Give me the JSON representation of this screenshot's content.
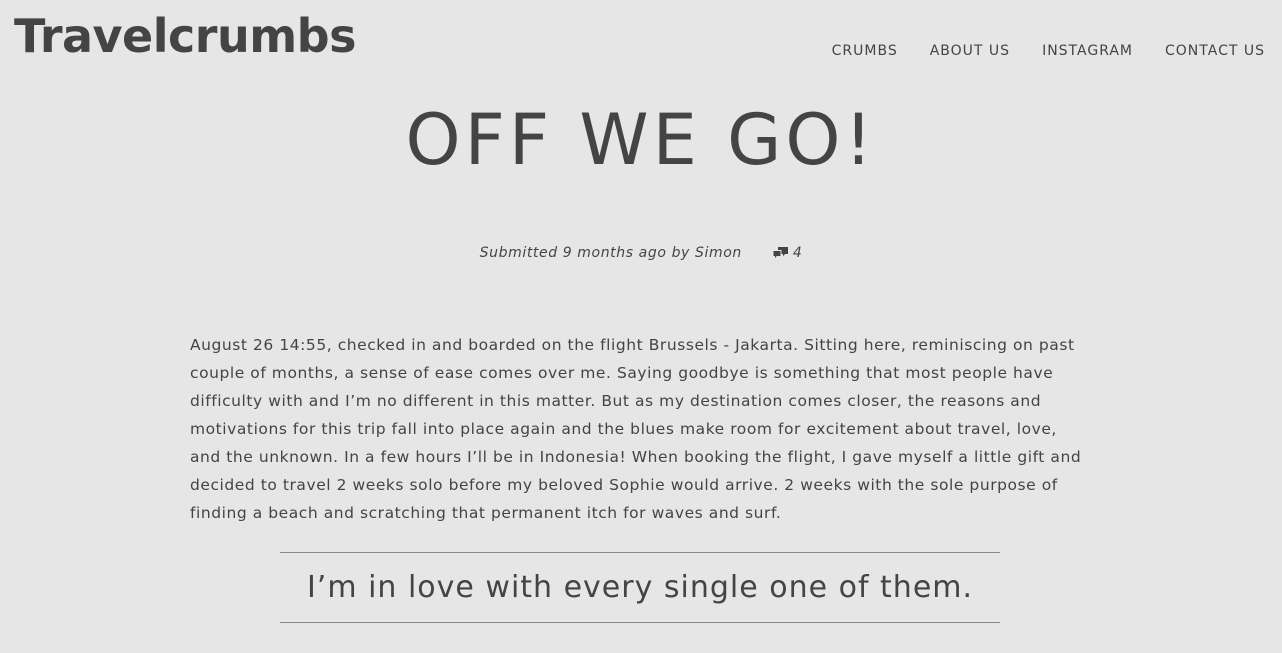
{
  "header": {
    "site_title": "Travelcrumbs",
    "nav": [
      {
        "label": "CRUMBS"
      },
      {
        "label": "ABOUT US"
      },
      {
        "label": "INSTAGRAM"
      },
      {
        "label": "CONTACT US"
      }
    ]
  },
  "post": {
    "title": "OFF WE GO!",
    "meta": {
      "submitted_text": "Submitted 9 months ago by Simon",
      "comments_icon": "comments-icon",
      "comments_count": "4"
    },
    "body": "August 26 14:55, checked in and boarded on the flight Brussels - Jakarta. Sitting here, reminiscing on past couple of months, a sense of ease comes over me. Saying goodbye is something that most people have difficulty with and I’m no different in this matter. But as my destination comes closer, the reasons and motivations for this trip fall into place again and the blues make room for excitement about travel, love, and the unknown. In a few hours I’ll be in Indonesia! When booking the flight, I gave myself a little gift and decided to travel 2 weeks solo before my beloved Sophie would arrive. 2 weeks with the sole purpose of finding a beach and scratching that permanent itch for waves and surf.",
    "pull_quote": "I’m in love with every single one of them."
  },
  "colors": {
    "background": "#e6e6e6",
    "text": "#444444",
    "rule": "#8a8a8a"
  }
}
